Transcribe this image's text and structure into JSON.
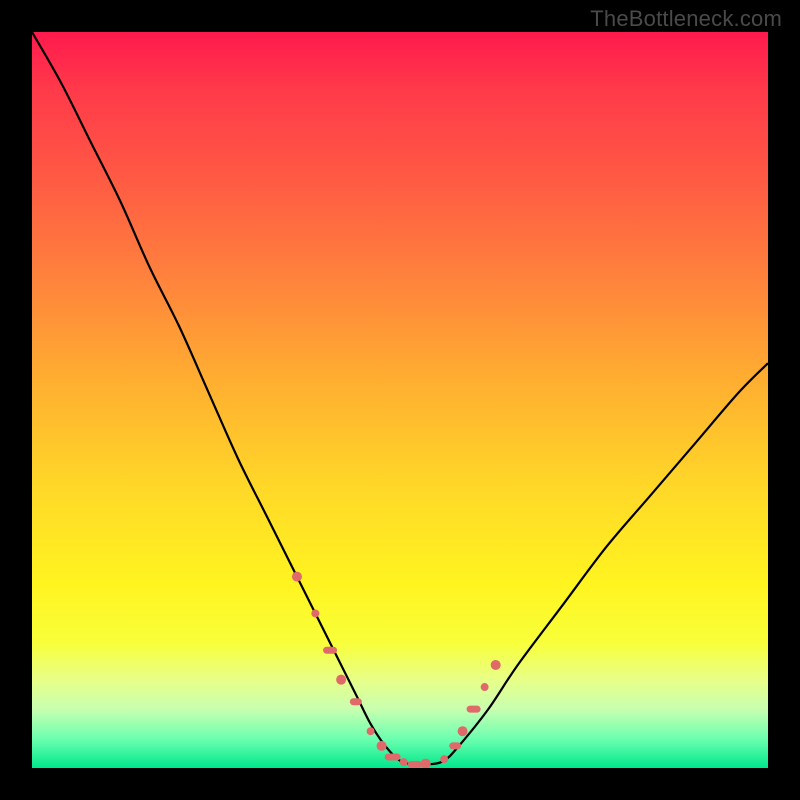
{
  "attribution": "TheBottleneck.com",
  "chart_data": {
    "type": "line",
    "title": "",
    "xlabel": "",
    "ylabel": "",
    "xlim": [
      0,
      100
    ],
    "ylim": [
      0,
      100
    ],
    "series": [
      {
        "name": "bottleneck-curve",
        "x": [
          0,
          4,
          8,
          12,
          16,
          20,
          24,
          28,
          32,
          36,
          40,
          44,
          46,
          48,
          50,
          52,
          54,
          56,
          58,
          62,
          66,
          72,
          78,
          84,
          90,
          96,
          100
        ],
        "y": [
          100,
          93,
          85,
          77,
          68,
          60,
          51,
          42,
          34,
          26,
          18,
          10,
          6,
          3,
          1,
          0.5,
          0.5,
          1,
          3,
          8,
          14,
          22,
          30,
          37,
          44,
          51,
          55
        ]
      }
    ],
    "markers": {
      "name": "highlight-points",
      "color": "#e06a6a",
      "x": [
        36,
        38.5,
        40.5,
        42,
        44,
        46,
        47.5,
        49,
        50.5,
        52,
        53.5,
        56,
        57.5,
        58.5,
        60,
        61.5,
        63
      ],
      "y": [
        26,
        21,
        16,
        12,
        9,
        5,
        3,
        1.5,
        0.8,
        0.5,
        0.6,
        1.2,
        3,
        5,
        8,
        11,
        14
      ],
      "style": "irregular-dots-and-dashes"
    },
    "background_gradient": {
      "top": "#ff1a4d",
      "mid": "#ffd828",
      "bottom": "#00e88c"
    }
  }
}
